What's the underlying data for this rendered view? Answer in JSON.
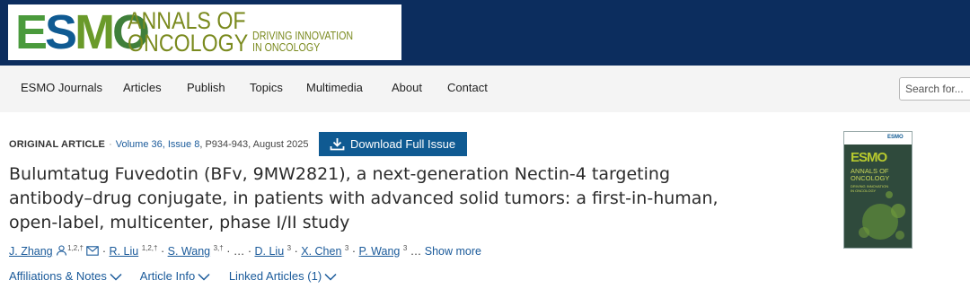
{
  "header": {
    "logo_esmo": "ESMO",
    "logo_annals_line1": "ANNALS OF",
    "logo_annals_line2": "ONCOLOGY",
    "tagline_line1": "DRIVING INNOVATION",
    "tagline_line2": "IN ONCOLOGY",
    "colors": {
      "band": "#0c2d5e",
      "E": "#4a9a3c",
      "S": "#0f5a92",
      "M": "#6a9a2a",
      "O": "#4a8a3a"
    }
  },
  "nav": {
    "items": [
      "ESMO Journals",
      "Articles",
      "Publish",
      "Topics",
      "Multimedia",
      "About",
      "Contact"
    ],
    "search_placeholder": "Search for..."
  },
  "article": {
    "type": "ORIGINAL ARTICLE",
    "volume_issue": "Volume 36, Issue 8",
    "pages_date": "P934-943, August 2025",
    "download_label": "Download Full Issue",
    "title": "Bulumtatug Fuvedotin (BFv, 9MW2821), a next-generation Nectin-4 targeting antibody–drug conjugate, in patients with advanced solid tumors: a first-in-human, open-label, multicenter, phase I/II study",
    "authors": [
      {
        "name": "J. Zhang",
        "sup": "1,2,†"
      },
      {
        "name": "R. Liu",
        "sup": "1,2,†"
      },
      {
        "name": "S. Wang",
        "sup": "3,†"
      },
      {
        "name": "D. Liu",
        "sup": "3"
      },
      {
        "name": "X. Chen",
        "sup": "3"
      },
      {
        "name": "P. Wang",
        "sup": "3"
      }
    ],
    "ellipsis": "…",
    "show_more": "Show more",
    "links": [
      "Affiliations & Notes",
      "Article Info",
      "Linked Articles (1)"
    ]
  },
  "cover": {
    "brand": "ESMO",
    "title_line1": "ANNALS OF",
    "title_line2": "ONCOLOGY",
    "sub_line1": "DRIVING INNOVATION",
    "sub_line2": "IN ONCOLOGY",
    "badge": "ESMO"
  }
}
